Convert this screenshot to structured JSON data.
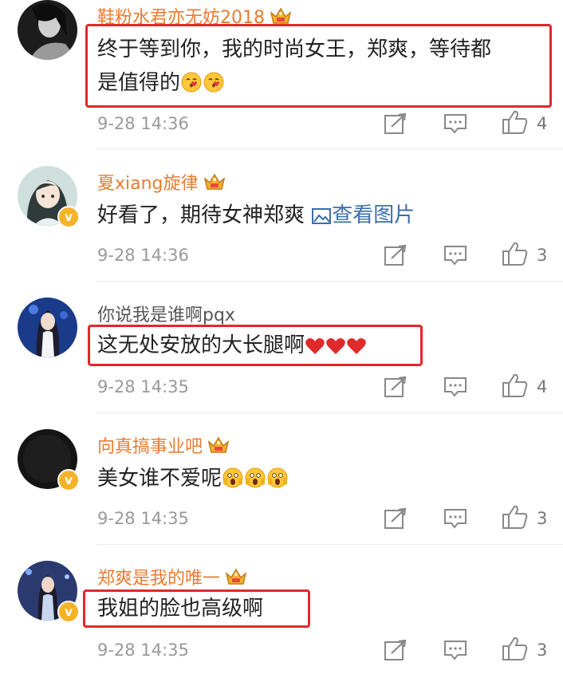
{
  "comments": [
    {
      "username": "鞋粉水君亦无妨2018",
      "text_line1": "终于等到你，我的时尚女王，郑爽，等待都",
      "text_line2": "是值得的",
      "emoji": "kiss-face-emoji",
      "emoji_count": 2,
      "time": "9-28 14:36",
      "likes": "4",
      "vip": true,
      "verified": false,
      "highlighted": true
    },
    {
      "username": "夏xiang旋律",
      "text": "好看了，期待女神郑爽",
      "link_icon": "image-icon",
      "link_text": "查看图片",
      "time": "9-28 14:36",
      "likes": "3",
      "vip": true,
      "verified": true,
      "highlighted": false
    },
    {
      "username": "你说我是谁啊pqx",
      "text": "这无处安放的大长腿啊",
      "emoji": "red-heart-emoji",
      "emoji_count": 3,
      "time": "9-28 14:35",
      "likes": "4",
      "vip": false,
      "verified": false,
      "highlighted": true
    },
    {
      "username": "向真搞事业吧",
      "text": "美女谁不爱呢",
      "emoji": "screaming-face-emoji",
      "emoji_count": 3,
      "time": "9-28 14:35",
      "likes": "3",
      "vip": true,
      "verified": true,
      "highlighted": false
    },
    {
      "username": "郑爽是我的唯一",
      "text": "我姐的脸也高级啊",
      "time": "9-28 14:35",
      "likes": "3",
      "vip": true,
      "verified": true,
      "highlighted": true
    }
  ],
  "icons": {
    "repost": "repost-icon",
    "reply": "comment-icon",
    "like": "thumbs-up-icon",
    "vip_badge": "crown-vip-icon",
    "verified_badge": "verified-v-icon"
  },
  "colors": {
    "username": "#eb7b30",
    "username_plain": "#555555",
    "highlight_border": "#e4262a",
    "link": "#3d6ea8",
    "timestamp": "#999999",
    "verified": "#f5b32a"
  }
}
